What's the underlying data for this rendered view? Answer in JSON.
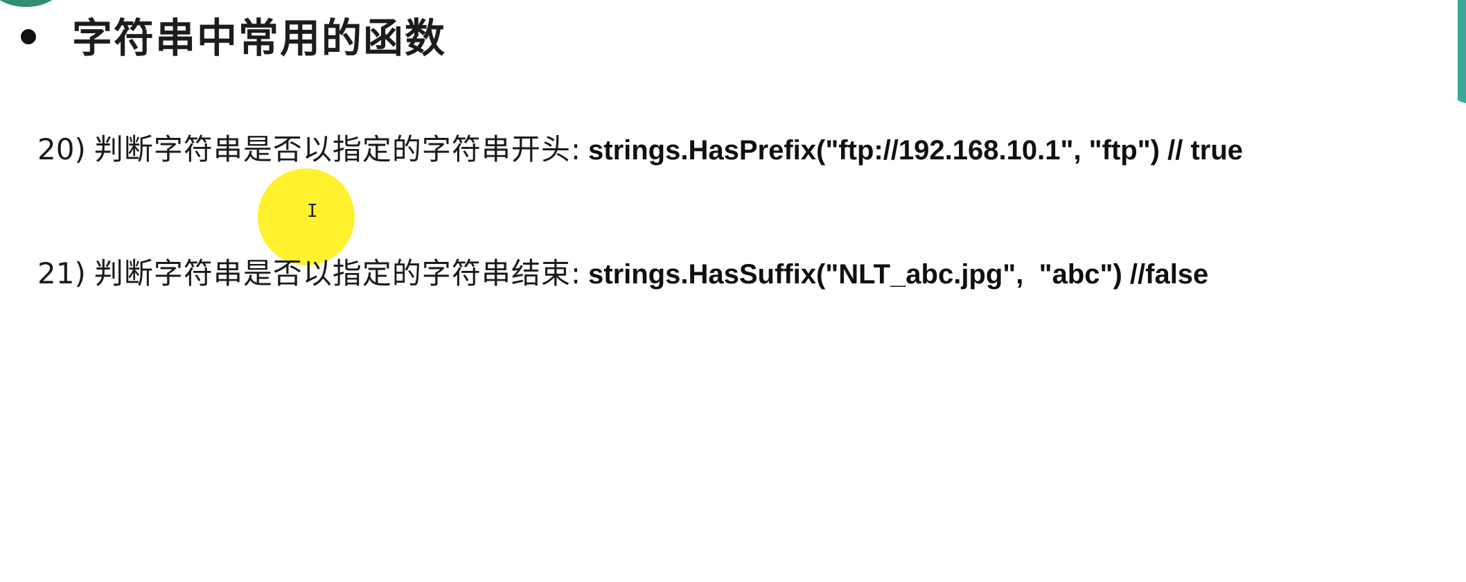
{
  "slide": {
    "title": "字符串中常用的函数",
    "items": [
      {
        "number": "20)",
        "description": "判断字符串是否以指定的字符串开头:",
        "code": "strings.HasPrefix(\"ftp://192.168.10.1\", \"ftp\") // true"
      },
      {
        "number": "21)",
        "description": "判断字符串是否以指定的字符串结束:",
        "code": "strings.HasSuffix(\"NLT_abc.jpg\",  \"abc\") //false"
      }
    ]
  },
  "colors": {
    "highlight": "#ffee00",
    "frame_accent": "#2aa591",
    "text": "#1a1a1a"
  },
  "icons": {
    "bullet": "bullet-dot-icon",
    "cursor": "text-cursor-icon"
  }
}
